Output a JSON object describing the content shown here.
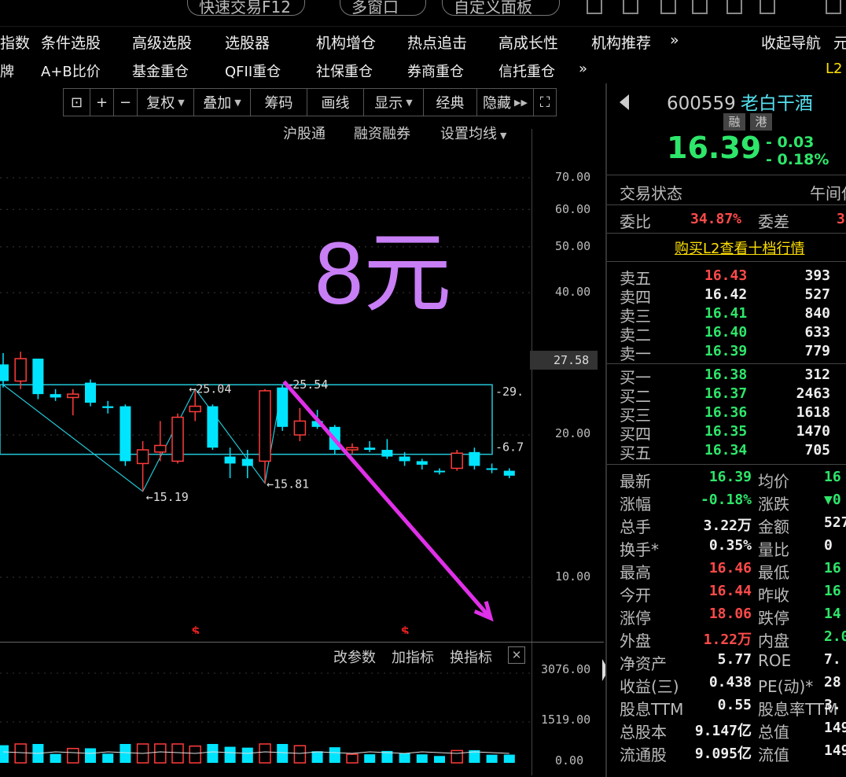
{
  "top": {
    "pill1": "快速交易F12",
    "pill2": "多窗口",
    "pill3": "自定义面板"
  },
  "menu_row1": [
    "指数",
    "条件选股",
    "高级选股",
    "选股器",
    "机构增仓",
    "热点追击",
    "高成长性",
    "机构推荐",
    "»",
    "收起导航",
    "元"
  ],
  "menu_row2": [
    "牌",
    "A+B比价",
    "基金重仓",
    "QFII重仓",
    "社保重仓",
    "券商重仓",
    "信托重仓",
    "»",
    "L2"
  ],
  "toolbar": {
    "lock": "⊡",
    "plus": "+",
    "minus": "−",
    "fuquan": "复权",
    "diejia": "叠加",
    "chouma": "筹码",
    "huaxian": "画线",
    "xianshi": "显示",
    "jingdian": "经典",
    "yincang": "隐藏",
    "fullscreen": "⛶"
  },
  "subbar": {
    "hugutong": "沪股通",
    "rongzi": "融资融券",
    "junxian": "设置均线"
  },
  "yaxis": [
    "70.00",
    "60.00",
    "50.00",
    "40.00",
    "20.00",
    "10.00"
  ],
  "price_tag": "27.58",
  "annotation": "8元",
  "chart_data": {
    "type": "candlestick",
    "yscale": "log",
    "ylim": [
      8.5,
      85
    ],
    "candles": [
      {
        "o": 28.2,
        "h": 29.8,
        "l": 25.2,
        "c": 26.0
      },
      {
        "o": 26.0,
        "h": 30.0,
        "l": 25.0,
        "c": 29.0
      },
      {
        "o": 29.0,
        "h": 29.0,
        "l": 23.8,
        "c": 24.4
      },
      {
        "o": 24.4,
        "h": 25.0,
        "l": 23.6,
        "c": 24.0
      },
      {
        "o": 24.0,
        "h": 25.0,
        "l": 22.0,
        "c": 24.4
      },
      {
        "o": 25.8,
        "h": 26.2,
        "l": 23.0,
        "c": 23.4
      },
      {
        "o": 23.0,
        "h": 23.6,
        "l": 22.2,
        "c": 22.8
      },
      {
        "o": 23.0,
        "h": 23.2,
        "l": 17.2,
        "c": 17.6
      },
      {
        "o": 17.4,
        "h": 19.4,
        "l": 15.19,
        "c": 18.6
      },
      {
        "o": 18.4,
        "h": 21.4,
        "l": 17.6,
        "c": 19.0
      },
      {
        "o": 17.6,
        "h": 22.2,
        "l": 17.4,
        "c": 21.8
      },
      {
        "o": 22.4,
        "h": 25.04,
        "l": 21.4,
        "c": 23.0
      },
      {
        "o": 23.0,
        "h": 23.2,
        "l": 18.6,
        "c": 18.8
      },
      {
        "o": 18.0,
        "h": 18.8,
        "l": 16.2,
        "c": 17.4
      },
      {
        "o": 17.8,
        "h": 18.6,
        "l": 16.2,
        "c": 17.2
      },
      {
        "o": 17.6,
        "h": 25.0,
        "l": 15.81,
        "c": 24.8
      },
      {
        "o": 25.2,
        "h": 25.54,
        "l": 20.4,
        "c": 20.8
      },
      {
        "o": 20.0,
        "h": 22.8,
        "l": 19.4,
        "c": 21.4
      },
      {
        "o": 21.4,
        "h": 22.6,
        "l": 20.6,
        "c": 20.8
      },
      {
        "o": 20.8,
        "h": 21.0,
        "l": 18.2,
        "c": 18.6
      },
      {
        "o": 18.6,
        "h": 19.2,
        "l": 18.2,
        "c": 18.8
      },
      {
        "o": 18.8,
        "h": 19.4,
        "l": 18.4,
        "c": 18.6
      },
      {
        "o": 18.6,
        "h": 19.6,
        "l": 17.8,
        "c": 18.0
      },
      {
        "o": 18.0,
        "h": 18.4,
        "l": 17.2,
        "c": 17.6
      },
      {
        "o": 17.6,
        "h": 17.8,
        "l": 16.9,
        "c": 17.3
      },
      {
        "o": 16.8,
        "h": 17.0,
        "l": 16.5,
        "c": 16.7
      },
      {
        "o": 17.0,
        "h": 18.6,
        "l": 16.8,
        "c": 18.3
      },
      {
        "o": 18.4,
        "h": 18.8,
        "l": 16.9,
        "c": 17.2
      },
      {
        "o": 17.0,
        "h": 17.4,
        "l": 16.6,
        "c": 16.9
      },
      {
        "o": 16.8,
        "h": 17.0,
        "l": 16.2,
        "c": 16.4
      }
    ],
    "labels": [
      "25.04",
      "25.54",
      "15.19",
      "15.81",
      "29.",
      "6.7"
    ],
    "box_high": 25.54,
    "box_low": 18.2,
    "markers": [
      "$",
      "$"
    ]
  },
  "indicator_bar": {
    "gaicanshu": "改参数",
    "jiazhibiao": "加指标",
    "huanzhibiao": "换指标",
    "close": "✕"
  },
  "vol_axis": [
    "3076.00",
    "1519.00",
    "0.00"
  ],
  "right": {
    "code": "600559",
    "name": "老白干酒",
    "tag1": "融",
    "tag2": "港",
    "price": "16.39",
    "change": "- 0.03",
    "change_pct": "- 0.18%",
    "status_label": "交易状态",
    "status_val": "午间休",
    "weibi_label": "委比",
    "weibi_val": "34.87%",
    "weicha_label": "委差",
    "weicha_val": "3",
    "buy_l2": "购买L2查看十档行情",
    "sells": [
      {
        "label": "卖五",
        "price": "16.43",
        "vol": "393",
        "cls": "red"
      },
      {
        "label": "卖四",
        "price": "16.42",
        "vol": "527",
        "cls": "white"
      },
      {
        "label": "卖三",
        "price": "16.41",
        "vol": "840",
        "cls": "green"
      },
      {
        "label": "卖二",
        "price": "16.40",
        "vol": "633",
        "cls": "green"
      },
      {
        "label": "卖一",
        "price": "16.39",
        "vol": "779",
        "cls": "green"
      }
    ],
    "buys": [
      {
        "label": "买一",
        "price": "16.38",
        "vol": "312",
        "cls": "green"
      },
      {
        "label": "买二",
        "price": "16.37",
        "vol": "2463",
        "cls": "green"
      },
      {
        "label": "买三",
        "price": "16.36",
        "vol": "1618",
        "cls": "green"
      },
      {
        "label": "买四",
        "price": "16.35",
        "vol": "1470",
        "cls": "green"
      },
      {
        "label": "买五",
        "price": "16.34",
        "vol": "705",
        "cls": "green"
      }
    ],
    "stats": [
      {
        "l1": "最新",
        "v1": "16.39",
        "c1": "green",
        "l2": "均价",
        "v2": "16"
      },
      {
        "l1": "涨幅",
        "v1": "-0.18%",
        "c1": "green",
        "l2": "涨跌",
        "v2": "▼0"
      },
      {
        "l1": "总手",
        "v1": "3.22万",
        "c1": "white",
        "l2": "金额",
        "v2": "527"
      },
      {
        "l1": "换手*",
        "v1": "0.35%",
        "c1": "white",
        "l2": "量比",
        "v2": "0"
      },
      {
        "l1": "最高",
        "v1": "16.46",
        "c1": "red",
        "l2": "最低",
        "v2": "16"
      },
      {
        "l1": "今开",
        "v1": "16.44",
        "c1": "red",
        "l2": "昨收",
        "v2": "16"
      },
      {
        "l1": "涨停",
        "v1": "18.06",
        "c1": "red",
        "l2": "跌停",
        "v2": "14"
      },
      {
        "l1": "外盘",
        "v1": "1.22万",
        "c1": "red",
        "l2": "内盘",
        "v2": "2.0"
      },
      {
        "l1": "净资产",
        "v1": "5.77",
        "c1": "white",
        "l2": "ROE",
        "v2": "7."
      },
      {
        "l1": "收益(三)",
        "v1": "0.438",
        "c1": "white",
        "l2": "PE(动)*",
        "v2": "28"
      },
      {
        "l1": "股息TTM",
        "v1": "0.55",
        "c1": "white",
        "l2": "股息率TTM",
        "v2": "3."
      },
      {
        "l1": "总股本",
        "v1": "9.147亿",
        "c1": "white",
        "l2": "总值",
        "v2": "149"
      },
      {
        "l1": "流通股",
        "v1": "9.095亿",
        "c1": "white",
        "l2": "流值",
        "v2": "149"
      }
    ]
  },
  "colors": {
    "up": "#ff3b3b",
    "down": "#00e5ff",
    "box": "#22c8d8",
    "arrow": "#e030e8",
    "annotation": "#c87ef5"
  }
}
